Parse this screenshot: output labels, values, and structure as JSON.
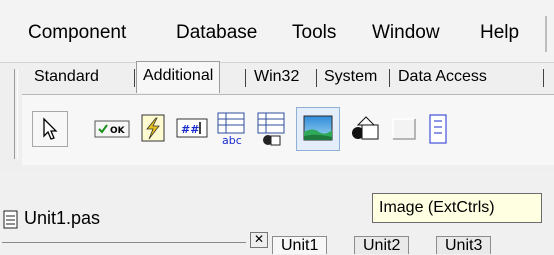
{
  "menu": {
    "items": [
      "Component",
      "Database",
      "Tools",
      "Window",
      "Help"
    ]
  },
  "palette": {
    "tabs": [
      "Standard",
      "Additional",
      "Win32",
      "System",
      "Data Access"
    ],
    "active_tab": "Additional"
  },
  "tooltip": {
    "text": "Image (ExtCtrls)"
  },
  "editor": {
    "file_title": "Unit1.pas"
  },
  "bottom_tabs": [
    "Unit1",
    "Unit2",
    "Unit3"
  ],
  "colors": {
    "tooltip_bg": "#ffffe1",
    "selection_bg": "#e4eefa",
    "selection_border": "#8fb1d8"
  }
}
